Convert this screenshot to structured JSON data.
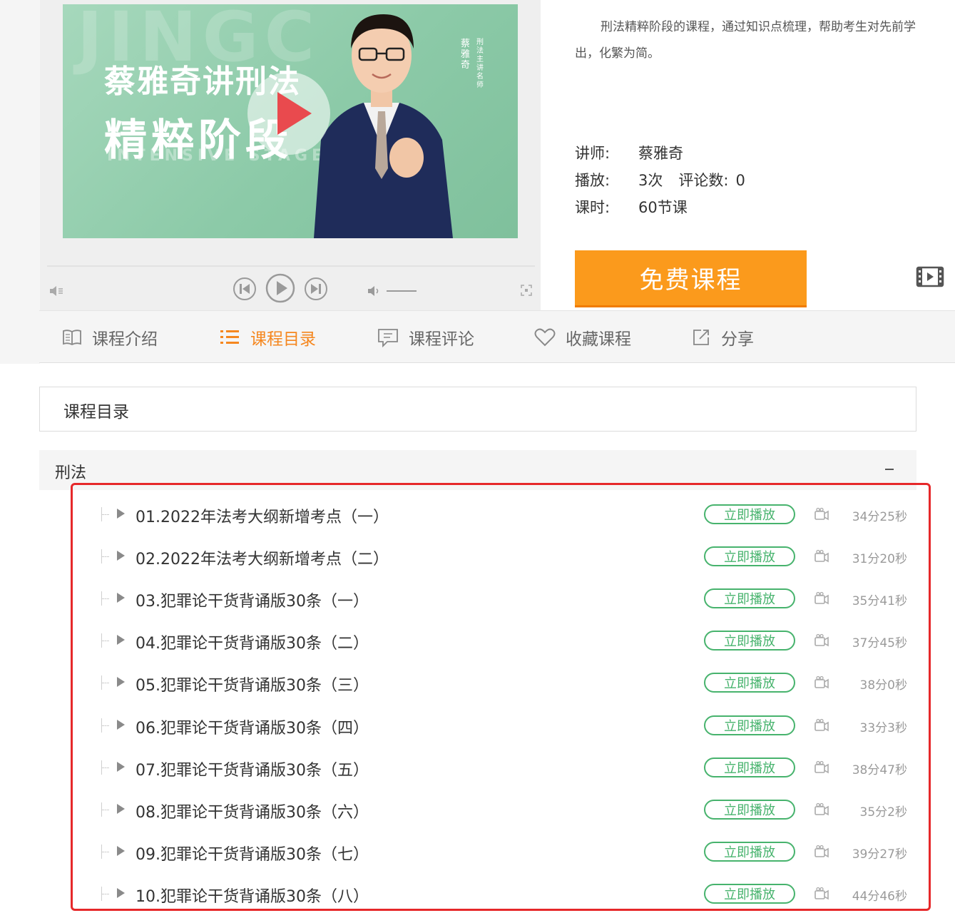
{
  "poster": {
    "title_line1": "蔡雅奇讲刑法",
    "title_line2": "精粹阶段",
    "stage_text": "INTENSIVE STAGE",
    "watermark": "JINGC",
    "teacher_vertical": "蔡雅奇",
    "teacher_subtitle": "刑法主讲名师"
  },
  "course": {
    "description_line1": "刑法精粹阶段的课程，通过知识点梳理，帮助考生对先前学",
    "description_line2": "出，化繁为简。",
    "teacher_label": "讲师:",
    "teacher_value": "蔡雅奇",
    "plays_label": "播放:",
    "plays_value": "3次",
    "comments_label": "评论数:",
    "comments_value": "0",
    "lessons_label": "课时:",
    "lessons_value": "60节课",
    "free_button": "免费课程"
  },
  "tabs": [
    {
      "label": "课程介绍",
      "icon": "book-icon"
    },
    {
      "label": "课程目录",
      "icon": "list-icon",
      "active": true
    },
    {
      "label": "课程评论",
      "icon": "comment-icon"
    },
    {
      "label": "收藏课程",
      "icon": "heart-icon"
    },
    {
      "label": "分享",
      "icon": "share-icon"
    }
  ],
  "catalogue": {
    "heading": "课程目录",
    "chapter": "刑法",
    "play_label": "立即播放",
    "lessons": [
      {
        "title": "01.2022年法考大纲新增考点（一）",
        "duration": "34分25秒"
      },
      {
        "title": "02.2022年法考大纲新增考点（二）",
        "duration": "31分20秒"
      },
      {
        "title": "03.犯罪论干货背诵版30条（一）",
        "duration": "35分41秒"
      },
      {
        "title": "04.犯罪论干货背诵版30条（二）",
        "duration": "37分45秒"
      },
      {
        "title": "05.犯罪论干货背诵版30条（三）",
        "duration": "38分0秒"
      },
      {
        "title": "06.犯罪论干货背诵版30条（四）",
        "duration": "33分3秒"
      },
      {
        "title": "07.犯罪论干货背诵版30条（五）",
        "duration": "38分47秒"
      },
      {
        "title": "08.犯罪论干货背诵版30条（六）",
        "duration": "35分2秒"
      },
      {
        "title": "09.犯罪论干货背诵版30条（七）",
        "duration": "39分27秒"
      },
      {
        "title": "10.犯罪论干货背诵版30条（八）",
        "duration": "44分46秒"
      }
    ]
  },
  "colors": {
    "accent_orange": "#f5871f",
    "button_orange": "#fb9a1c",
    "play_green": "#47b36d",
    "highlight_red": "#e6282a",
    "poster_green": "#9fd3b6"
  }
}
